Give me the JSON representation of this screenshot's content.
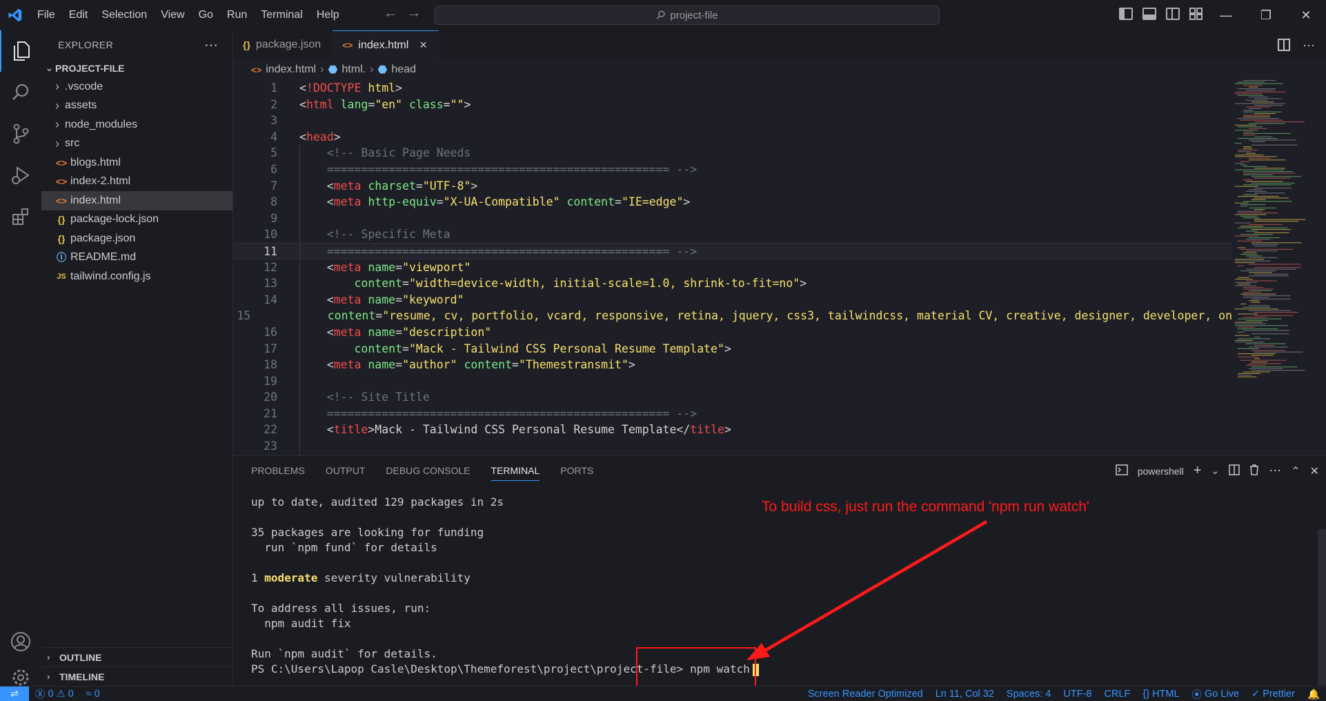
{
  "menu": [
    "File",
    "Edit",
    "Selection",
    "View",
    "Go",
    "Run",
    "Terminal",
    "Help"
  ],
  "search": {
    "placeholder": "project-file"
  },
  "sidebar": {
    "title": "EXPLORER",
    "project": "PROJECT-FILE",
    "items": [
      {
        "label": ".vscode",
        "type": "folder"
      },
      {
        "label": "assets",
        "type": "folder"
      },
      {
        "label": "node_modules",
        "type": "folder"
      },
      {
        "label": "src",
        "type": "folder"
      },
      {
        "label": "blogs.html",
        "type": "html"
      },
      {
        "label": "index-2.html",
        "type": "html"
      },
      {
        "label": "index.html",
        "type": "html",
        "selected": true
      },
      {
        "label": "package-lock.json",
        "type": "json"
      },
      {
        "label": "package.json",
        "type": "json"
      },
      {
        "label": "README.md",
        "type": "info"
      },
      {
        "label": "tailwind.config.js",
        "type": "js"
      }
    ],
    "outline": "OUTLINE",
    "timeline": "TIMELINE"
  },
  "tabs": [
    {
      "label": "package.json",
      "icon": "{}",
      "active": false
    },
    {
      "label": "index.html",
      "icon": "<>",
      "active": true,
      "close": "×"
    }
  ],
  "breadcrumb": [
    "index.html",
    "html.",
    "head"
  ],
  "editor": {
    "current_line": 11,
    "lines": [
      {
        "n": "1",
        "html": "<span class='t-punc'>&lt;</span><span class='t-doctype'>!DOCTYPE</span> <span class='t-kw'>html</span><span class='t-punc'>&gt;</span>"
      },
      {
        "n": "2",
        "html": "<span class='t-punc'>&lt;</span><span class='t-tag'>html</span> <span class='t-attr'>lang</span>=<span class='t-str'>\"en\"</span> <span class='t-attr'>class</span>=<span class='t-str'>\"\"</span><span class='t-punc'>&gt;</span>"
      },
      {
        "n": "3",
        "html": ""
      },
      {
        "n": "4",
        "html": "<span class='t-punc'>&lt;</span><span class='t-tag'>head</span><span class='t-punc'>&gt;</span>"
      },
      {
        "n": "5",
        "html": "    <span class='t-comment'>&lt;!-- Basic Page Needs</span>"
      },
      {
        "n": "6",
        "html": "    <span class='t-comment'>================================================== --&gt;</span>"
      },
      {
        "n": "7",
        "html": "    <span class='t-punc'>&lt;</span><span class='t-tag'>meta</span> <span class='t-attr'>charset</span>=<span class='t-str'>\"UTF-8\"</span><span class='t-punc'>&gt;</span>"
      },
      {
        "n": "8",
        "html": "    <span class='t-punc'>&lt;</span><span class='t-tag'>meta</span> <span class='t-attr'>http-equiv</span>=<span class='t-str'>\"X-UA-Compatible\"</span> <span class='t-attr'>content</span>=<span class='t-str'>\"IE=edge\"</span><span class='t-punc'>&gt;</span>"
      },
      {
        "n": "9",
        "html": ""
      },
      {
        "n": "10",
        "html": "    <span class='t-comment'>&lt;!-- Specific Meta</span>"
      },
      {
        "n": "11",
        "html": "    <span class='t-comment'>================================================== --&gt;</span>"
      },
      {
        "n": "12",
        "html": "    <span class='t-punc'>&lt;</span><span class='t-tag'>meta</span> <span class='t-attr'>name</span>=<span class='t-str'>\"viewport\"</span>"
      },
      {
        "n": "13",
        "html": "        <span class='t-attr'>content</span>=<span class='t-str'>\"width=device-width, initial-scale=1.0, shrink-to-fit=no\"</span><span class='t-punc'>&gt;</span>"
      },
      {
        "n": "14",
        "html": "    <span class='t-punc'>&lt;</span><span class='t-tag'>meta</span> <span class='t-attr'>name</span>=<span class='t-str'>\"keyword\"</span>"
      },
      {
        "n": "15",
        "html": "        <span class='t-attr'>content</span>=<span class='t-str'>\"resume, cv, portfolio, vcard, responsive, retina, jquery, css3, tailwindcss, material CV, creative, designer, developer, on</span>"
      },
      {
        "n": "16",
        "html": "    <span class='t-punc'>&lt;</span><span class='t-tag'>meta</span> <span class='t-attr'>name</span>=<span class='t-str'>\"description\"</span>"
      },
      {
        "n": "17",
        "html": "        <span class='t-attr'>content</span>=<span class='t-str'>\"Mack - Tailwind CSS Personal Resume Template\"</span><span class='t-punc'>&gt;</span>"
      },
      {
        "n": "18",
        "html": "    <span class='t-punc'>&lt;</span><span class='t-tag'>meta</span> <span class='t-attr'>name</span>=<span class='t-str'>\"author\"</span> <span class='t-attr'>content</span>=<span class='t-str'>\"Themestransmit\"</span><span class='t-punc'>&gt;</span>"
      },
      {
        "n": "19",
        "html": ""
      },
      {
        "n": "20",
        "html": "    <span class='t-comment'>&lt;!-- Site Title</span>"
      },
      {
        "n": "21",
        "html": "    <span class='t-comment'>================================================== --&gt;</span>"
      },
      {
        "n": "22",
        "html": "    <span class='t-punc'>&lt;</span><span class='t-tag'>title</span><span class='t-punc'>&gt;</span>Mack - Tailwind CSS Personal Resume Template<span class='t-punc'>&lt;/</span><span class='t-tag'>title</span><span class='t-punc'>&gt;</span>"
      },
      {
        "n": "23",
        "html": ""
      }
    ]
  },
  "panel": {
    "tabs": [
      "PROBLEMS",
      "OUTPUT",
      "DEBUG CONSOLE",
      "TERMINAL",
      "PORTS"
    ],
    "active_tab": "TERMINAL",
    "shell": "powershell",
    "terminal_lines": [
      "up to date, audited 129 packages in 2s",
      "",
      "35 packages are looking for funding",
      "  run `npm fund` for details",
      "",
      "1 |moderate| severity vulnerability",
      "",
      "To address all issues, run:",
      "  npm audit fix",
      "",
      "Run `npm audit` for details."
    ],
    "prompt": "PS C:\\Users\\Lapop Casle\\Desktop\\Themeforest\\project\\project-file>",
    "command": "npm watch"
  },
  "annotation": {
    "text": "To build css, just run the command 'npm run watch'",
    "color": "#ff1a1a"
  },
  "statusbar": {
    "errors": "0",
    "warnings": "0",
    "ports": "0",
    "screen_reader": "Screen Reader Optimized",
    "position": "Ln 11, Col 32",
    "spaces": "Spaces: 4",
    "encoding": "UTF-8",
    "eol": "CRLF",
    "language": "HTML",
    "golive": "Go Live",
    "prettier": "Prettier"
  }
}
